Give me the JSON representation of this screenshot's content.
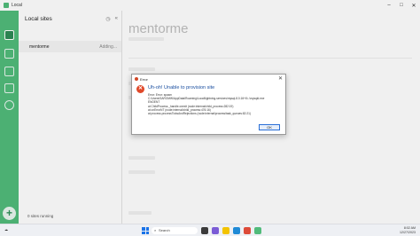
{
  "window": {
    "title": "Local"
  },
  "sidebar": {
    "heading": "Local sites",
    "sites": [
      {
        "name": "mentorme",
        "status": "Adding..."
      }
    ],
    "footer": "0 sites running"
  },
  "main": {
    "site_title": "mentorme"
  },
  "dialog": {
    "title": "Error",
    "heading": "Uh-oh! Unable to provision site",
    "body_lines": [
      "Error: Error: spawn",
      "C:\\Users\\SAROMW\\AppData\\Roaming\\Local\\lightning-services\\mysql-8.0.16+6\\..\\mysqld.exe",
      "ENOENT",
      "at ChildProcess._handle.onexit (node:internal/child_process:282:19)",
      "at onErrorNT (node:internal/child_process:476:16)",
      "at process.processTicksAndRejections (node:internal/process/task_queues:82:21)"
    ],
    "ok_label": "OK"
  },
  "taskbar": {
    "search_label": "Search",
    "time": "8:02 AM",
    "date": "12/27/2023"
  }
}
